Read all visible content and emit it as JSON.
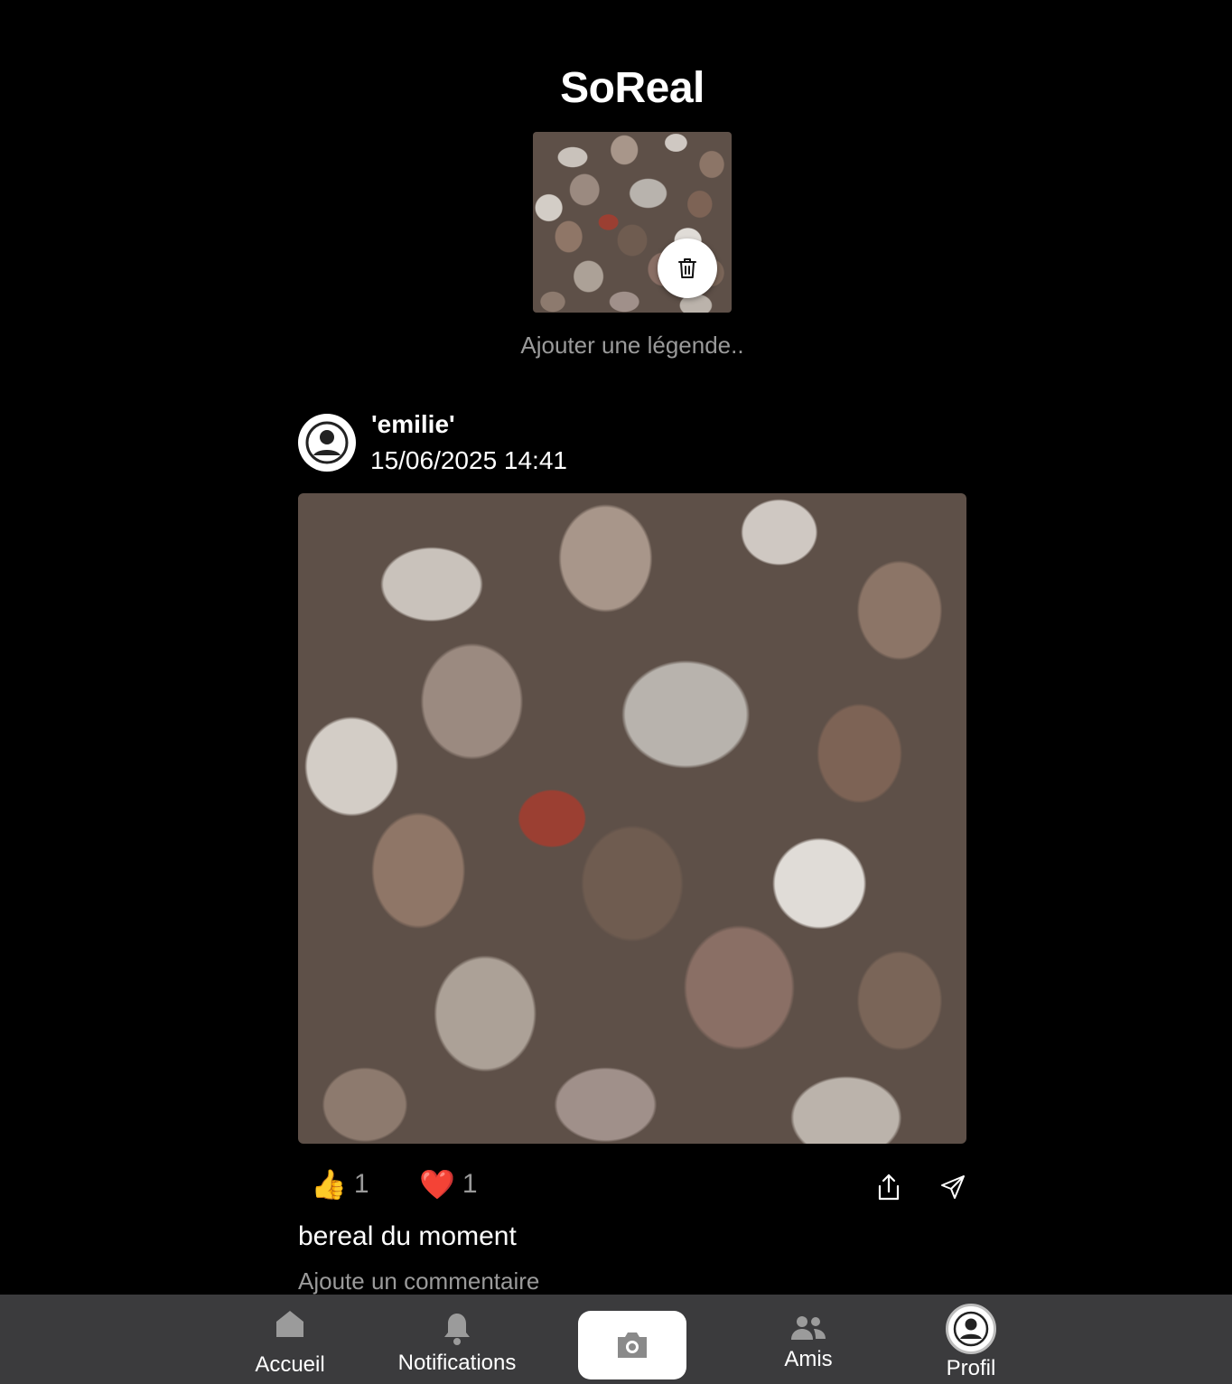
{
  "app": {
    "title": "SoReal"
  },
  "composer": {
    "caption_placeholder": "Ajouter une légende.."
  },
  "post": {
    "author": "'emilie'",
    "timestamp": "15/06/2025 14:41",
    "reactions": [
      {
        "emoji": "👍",
        "count": "1"
      },
      {
        "emoji": "❤️",
        "count": "1"
      }
    ],
    "caption": "bereal du moment",
    "comment_placeholder": "Ajoute un commentaire"
  },
  "nav": {
    "items": [
      {
        "label": "Accueil",
        "icon": "home-icon"
      },
      {
        "label": "Notifications",
        "icon": "bell-icon"
      },
      {
        "label": "",
        "icon": "camera-icon"
      },
      {
        "label": "Amis",
        "icon": "friends-icon"
      },
      {
        "label": "Profil",
        "icon": "profile-icon"
      }
    ]
  },
  "colors": {
    "background": "#000000",
    "nav_background": "#3b3b3d",
    "muted_text": "#9a9a9a"
  }
}
